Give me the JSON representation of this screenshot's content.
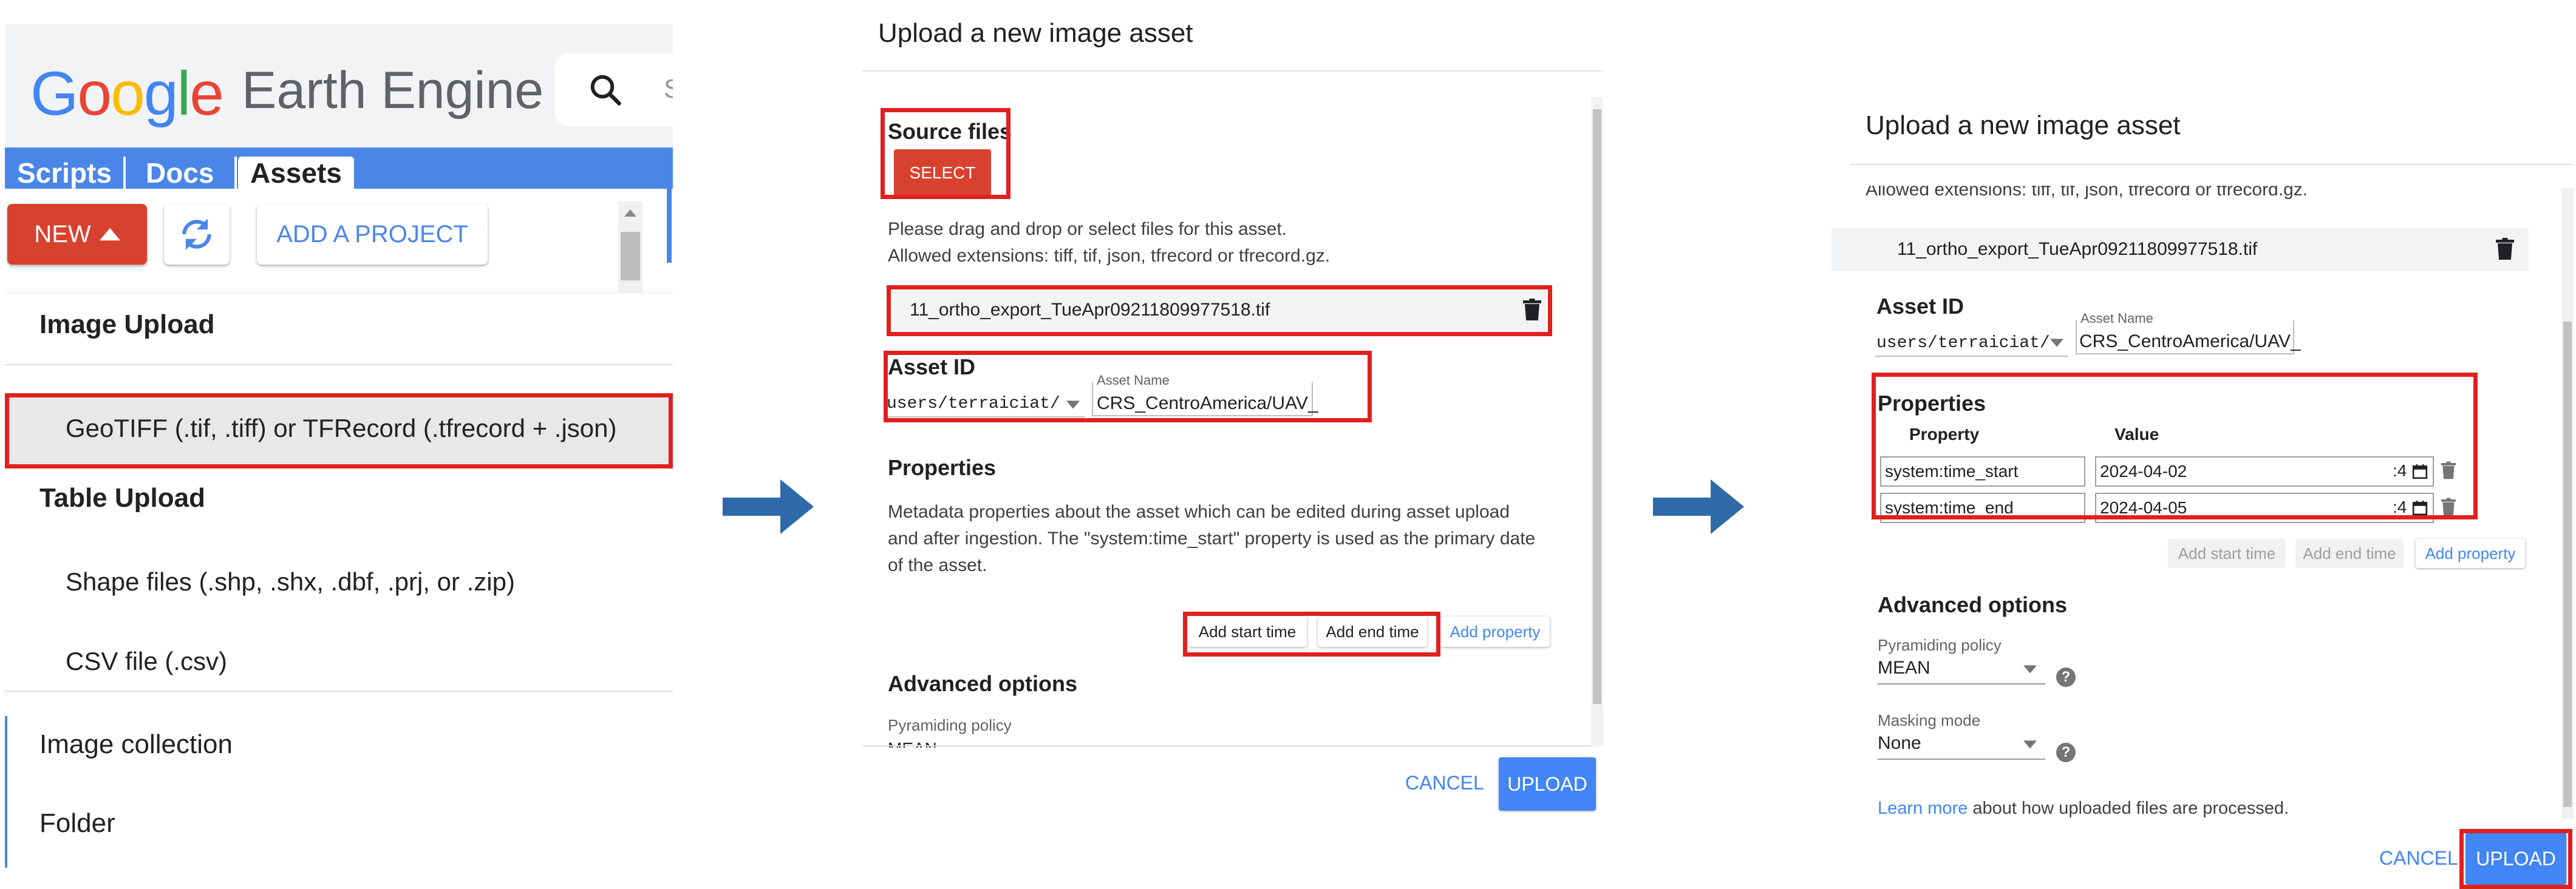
{
  "panel1": {
    "logo": {
      "google": "Google",
      "earth_engine": "Earth Engine"
    },
    "search_placeholder": "S",
    "tabs": [
      {
        "label": "Scripts"
      },
      {
        "label": "Docs"
      },
      {
        "label": "Assets"
      }
    ],
    "toolbar": {
      "new_label": "NEW",
      "add_project_label": "ADD A PROJECT"
    },
    "menu": {
      "image_upload_header": "Image Upload",
      "geotiff_item": "GeoTIFF (.tif, .tiff) or TFRecord (.tfrecord + .json)",
      "table_upload_header": "Table Upload",
      "shape_files_item": "Shape files (.shp, .shx, .dbf, .prj, or .zip)",
      "csv_item": "CSV file (.csv)",
      "image_collection_item": "Image collection",
      "folder_item": "Folder"
    }
  },
  "panel2": {
    "title": "Upload a new image asset",
    "source_files_label": "Source files",
    "select_label": "SELECT",
    "drag_text_1": "Please drag and drop or select files for this asset.",
    "drag_text_2": "Allowed extensions: tiff, tif, json, tfrecord or tfrecord.gz.",
    "file_name": "11_ortho_export_TueApr09211809977518.tif",
    "asset_id_label": "Asset ID",
    "asset_path": "users/terraiciat/",
    "asset_name_caption": "Asset Name",
    "asset_name_value": "CRS_CentroAmerica/UAV_",
    "properties_label": "Properties",
    "properties_desc_1": "Metadata properties about the asset which can be edited during asset upload",
    "properties_desc_2": "and after ingestion. The \"system:time_start\" property is used as the primary date",
    "properties_desc_3": "of the asset.",
    "add_start_time": "Add start time",
    "add_end_time": "Add end time",
    "add_property": "Add property",
    "advanced_options_label": "Advanced options",
    "pyramiding_label": "Pyramiding policy",
    "pyramiding_value": "MEAN",
    "cancel": "CANCEL",
    "upload": "UPLOAD"
  },
  "panel3": {
    "title": "Upload a new image asset",
    "allowed_text": "Allowed extensions: tiff, tif, json, tfrecord or tfrecord.gz.",
    "file_name": "11_ortho_export_TueApr09211809977518.tif",
    "asset_id_label": "Asset ID",
    "asset_path": "users/terraiciat/",
    "asset_name_caption": "Asset Name",
    "asset_name_value": "CRS_CentroAmerica/UAV_",
    "properties_label": "Properties",
    "col_property": "Property",
    "col_value": "Value",
    "rows": [
      {
        "property": "system:time_start",
        "value": "2024-04-02",
        "suffix": ":4"
      },
      {
        "property": "system:time_end",
        "value": "2024-04-05",
        "suffix": ":4"
      }
    ],
    "add_start_time": "Add start time",
    "add_end_time": "Add end time",
    "add_property": "Add property",
    "advanced_options_label": "Advanced options",
    "pyramiding_label": "Pyramiding policy",
    "pyramiding_value": "MEAN",
    "masking_label": "Masking mode",
    "masking_value": "None",
    "learn_more_link": "Learn more",
    "learn_more_rest": "about how uploaded files are processed.",
    "cancel": "CANCEL",
    "upload": "UPLOAD"
  },
  "colors": {
    "accent_blue": "#4285f4",
    "tab_blue": "#4a86e8",
    "new_red": "#d9412f",
    "highlight_red": "#e0201f",
    "arrow_blue": "#2e6aa8"
  },
  "icons": [
    "search-icon",
    "caret-up-icon",
    "refresh-icon",
    "trash-icon",
    "calendar-icon",
    "help-icon",
    "right-arrow-icon",
    "dropdown-caret-icon"
  ]
}
